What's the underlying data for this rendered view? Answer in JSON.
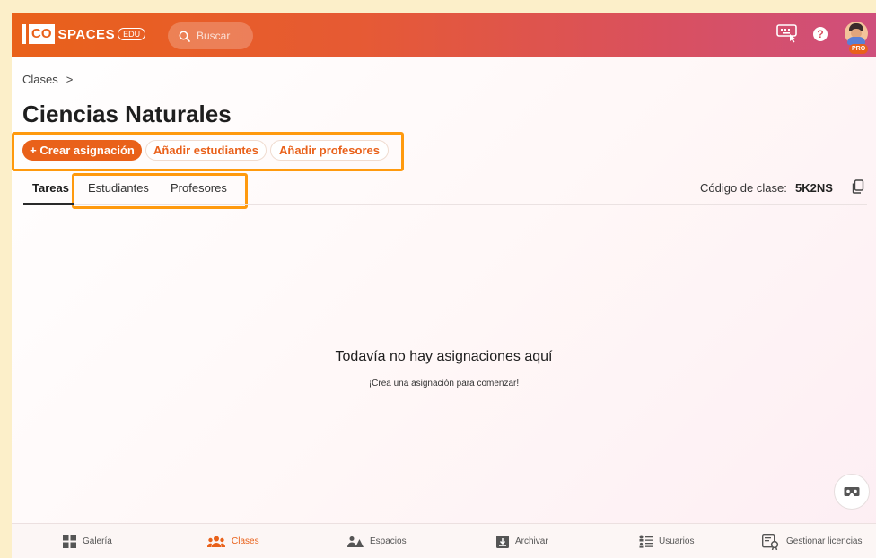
{
  "app": {
    "logo_co": "CO",
    "logo_spaces": "SPACES",
    "logo_edu": "EDU",
    "search_placeholder": "Buscar",
    "pro_badge": "PRO",
    "accent": "#e9611a",
    "highlight": "#ff9a0e"
  },
  "toolbar_icons": [
    "keyboard-touch-icon",
    "help-icon",
    "user-avatar"
  ],
  "breadcrumb": {
    "root": "Clases",
    "separator": ">"
  },
  "page": {
    "title": "Ciencias Naturales"
  },
  "actions": {
    "create": "+ Crear asignación",
    "add_students": "Añadir estudiantes",
    "add_teachers": "Añadir profesores"
  },
  "tabs": [
    {
      "label": "Tareas",
      "active": true
    },
    {
      "label": "Estudiantes",
      "active": false
    },
    {
      "label": "Profesores",
      "active": false
    }
  ],
  "class_code": {
    "label": "Código de clase:",
    "value": "5K2NS"
  },
  "empty_state": {
    "title": "Todavía no hay asignaciones aquí",
    "subtitle": "¡Crea una asignación para comenzar!"
  },
  "bottom_nav": [
    {
      "label": "Galería",
      "icon": "grid-icon",
      "active": false
    },
    {
      "label": "Clases",
      "icon": "people-icon",
      "active": true
    },
    {
      "label": "Espacios",
      "icon": "spaces-icon",
      "active": false
    },
    {
      "label": "Archivar",
      "icon": "archive-icon",
      "active": false
    },
    {
      "label": "Usuarios",
      "icon": "users-list-icon",
      "active": false
    },
    {
      "label": "Gestionar licencias",
      "icon": "license-icon",
      "active": false
    }
  ]
}
